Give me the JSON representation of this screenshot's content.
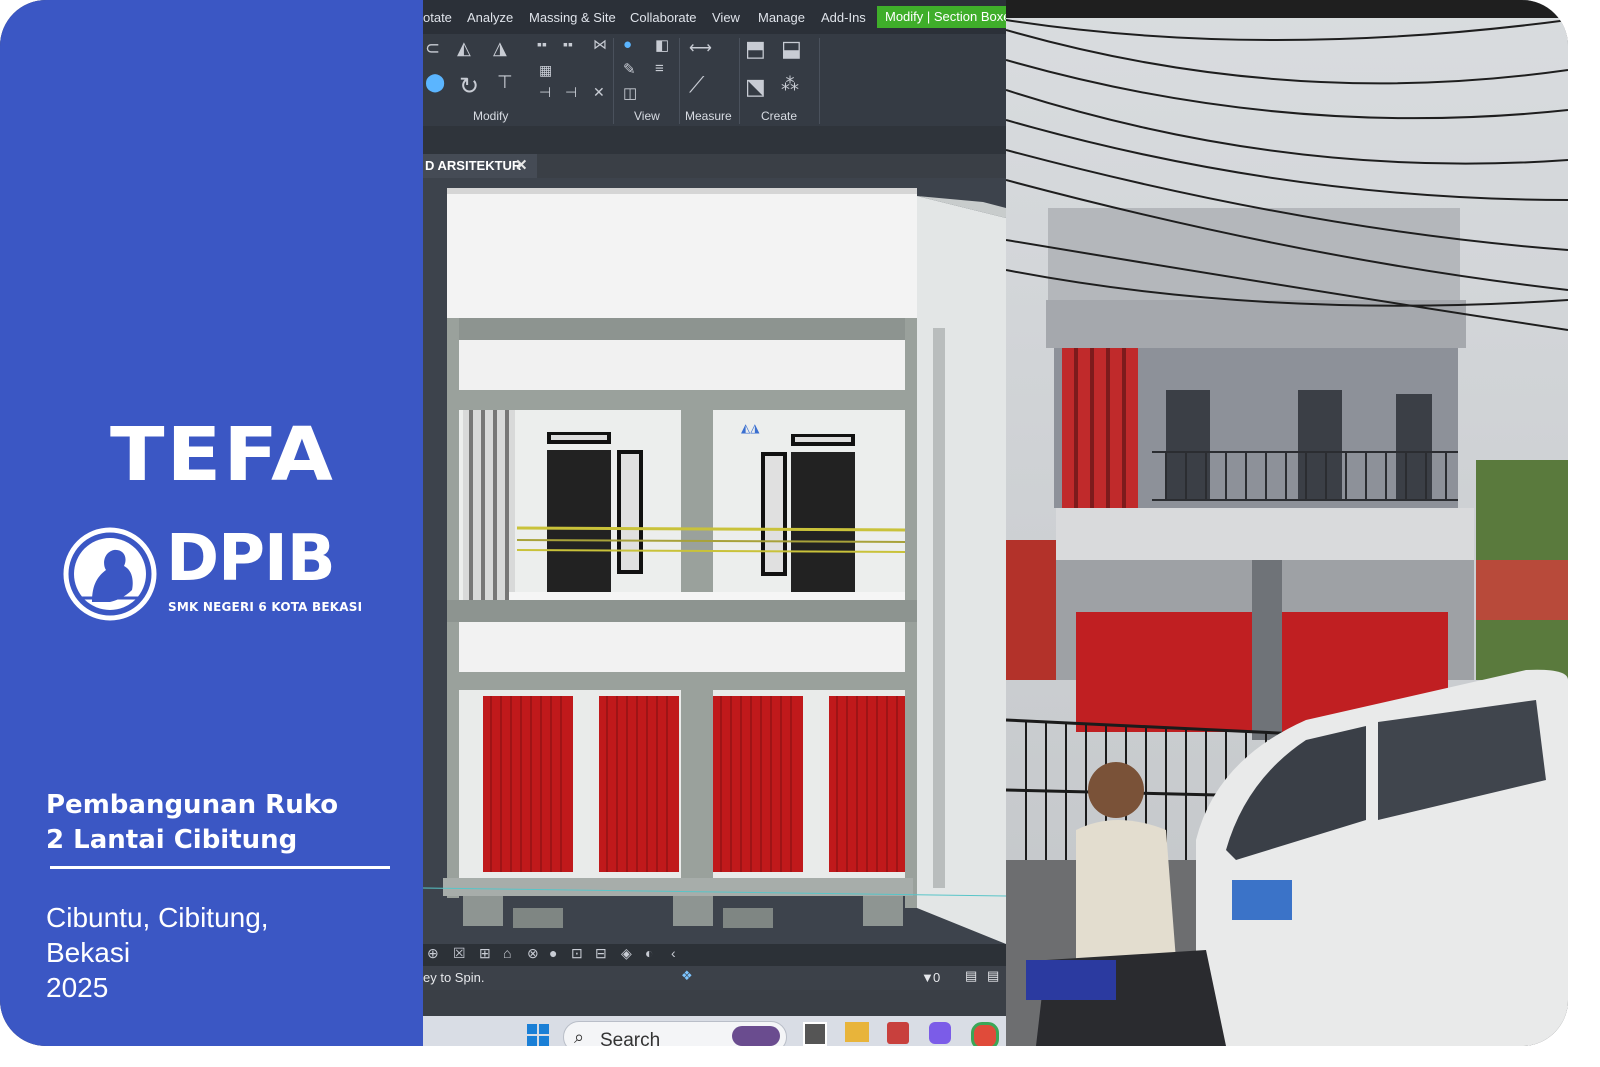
{
  "brand": {
    "tefa": "TEFA",
    "dpib": "DPIB",
    "school": "SMK NEGERI 6 KOTA BEKASI"
  },
  "project": {
    "title_line1": "Pembangunan Ruko",
    "title_line2": "2 Lantai Cibitung",
    "location_line1": "Cibuntu, Cibitung,",
    "location_line2": "Bekasi",
    "year": "2025"
  },
  "revit": {
    "menu": [
      "otate",
      "Analyze",
      "Massing & Site",
      "Collaborate",
      "View",
      "Manage",
      "Add-Ins"
    ],
    "active_tab": "Modify | Section Boxes",
    "ribbon_groups": [
      "Modify",
      "View",
      "Measure",
      "Create"
    ],
    "view_tab": "D ARSITEKTUR",
    "status_text": "ey to Spin.",
    "status_count": "0",
    "taskbar_search": "Search"
  },
  "colors": {
    "panel_blue": "#3b57c4",
    "active_green": "#3fae2a",
    "shutter_red": "#c0191b"
  },
  "icons": [
    "close-icon",
    "windows-start-icon",
    "search-icon",
    "filter-icon",
    "logo-emblem"
  ]
}
